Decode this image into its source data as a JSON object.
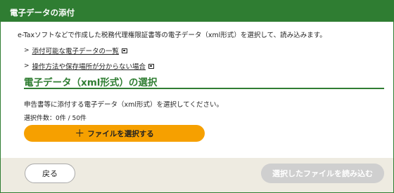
{
  "header": {
    "title": "電子データの添付"
  },
  "intro": {
    "text": "e-Taxソフトなどで作成した税務代理権限証書等の電子データ（xml形式）を選択して、読み込みます。"
  },
  "links": [
    {
      "chevron": ">",
      "label": "添付可能な電子データの一覧",
      "icon": "external-link-icon"
    },
    {
      "chevron": ">",
      "label": "操作方法や保存場所が分からない場合",
      "icon": "external-link-icon"
    }
  ],
  "section": {
    "title": "電子データ（xml形式）の選択",
    "description": "申告書等に添付する電子データ（xml形式）を選択してください。",
    "count_text": "選択件数：0件 / 50件",
    "select_button": {
      "plus": "＋",
      "label": "ファイルを選択する"
    }
  },
  "footer": {
    "back_label": "戻る",
    "load_label": "選択したファイルを読み込む"
  },
  "colors": {
    "brand": "#2f7d32",
    "accent": "#f6a000",
    "disabled": "#cfcfcf",
    "footer_bg": "#eeebe1"
  }
}
